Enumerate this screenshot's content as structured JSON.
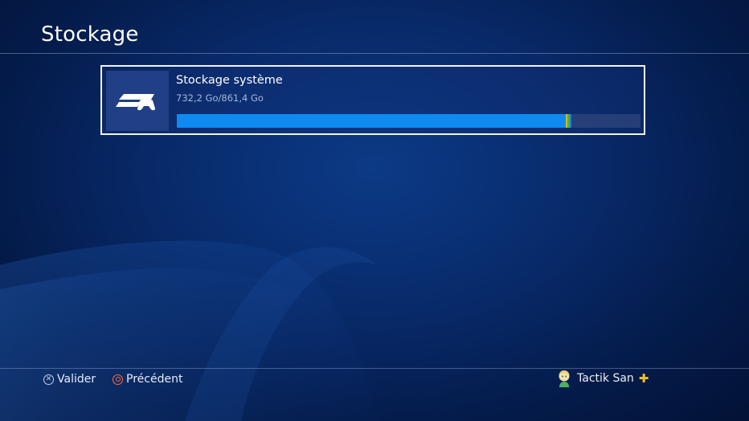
{
  "page": {
    "title": "Stockage"
  },
  "storage": {
    "name": "Stockage système",
    "usage_text": "732,2 Go/861,4 Go",
    "used_fraction": 0.85,
    "segments": [
      {
        "fraction": 0.838,
        "color": "#0f8af0"
      },
      {
        "fraction": 0.003,
        "color": "#e6b300"
      },
      {
        "fraction": 0.005,
        "color": "#44b648"
      },
      {
        "fraction": 0.004,
        "color": "#1e7fd0"
      }
    ],
    "icon": "ps4-console-icon"
  },
  "footer": {
    "confirm": {
      "icon": "cross-button-icon",
      "label": "Valider"
    },
    "back": {
      "icon": "circle-button-icon",
      "label": "Précédent"
    }
  },
  "user": {
    "name": "Tactik San",
    "badge_icon": "playstation-plus-icon",
    "avatar_icon": "avatar-icon"
  }
}
